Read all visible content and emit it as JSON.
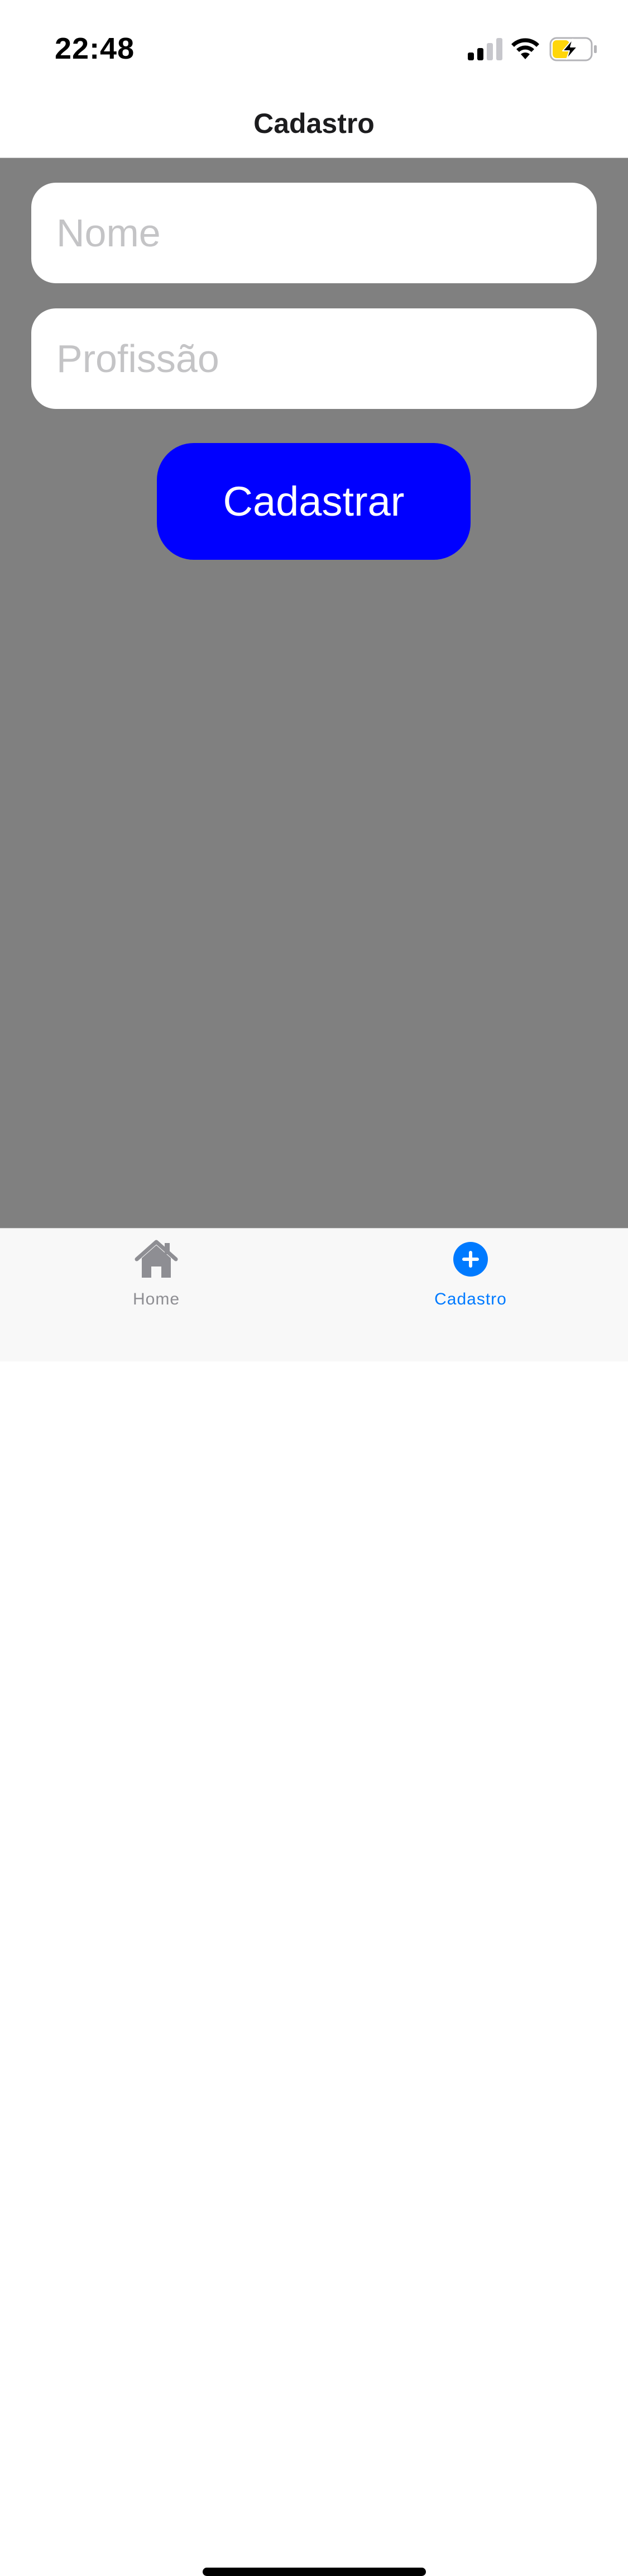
{
  "status_bar": {
    "time": "22:48"
  },
  "header": {
    "title": "Cadastro"
  },
  "form": {
    "nome_placeholder": "Nome",
    "nome_value": "",
    "profissao_placeholder": "Profissão",
    "profissao_value": "",
    "submit_label": "Cadastrar"
  },
  "tab_bar": {
    "items": [
      {
        "label": "Home",
        "icon": "home-icon",
        "active": false
      },
      {
        "label": "Cadastro",
        "icon": "add-circle-icon",
        "active": true
      }
    ]
  },
  "colors": {
    "content_background": "#808080",
    "button_background": "#0000ff",
    "active_tab": "#007aff",
    "inactive_tab": "#8e8e93",
    "battery_fill": "#ffd60a"
  }
}
